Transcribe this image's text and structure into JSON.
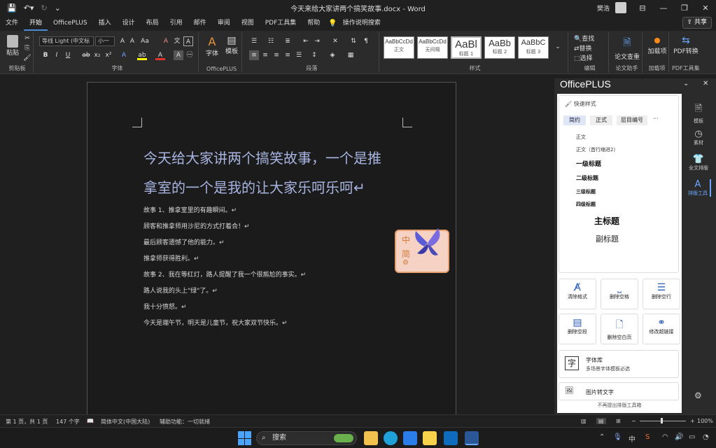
{
  "titlebar": {
    "doc_title": "今天来给大家讲两个搞笑故事.docx - Word",
    "user": "樊浩",
    "minimize": "—",
    "restore": "❐",
    "close": "✕",
    "ribbon_display": "⊟"
  },
  "tabs": [
    "文件",
    "开始",
    "OfficePLUS",
    "插入",
    "设计",
    "布局",
    "引用",
    "邮件",
    "审阅",
    "视图",
    "PDF工具集",
    "帮助",
    "操作说明搜索"
  ],
  "share_label": "共享",
  "ribbon": {
    "clipboard": {
      "paste": "粘贴",
      "label": "剪贴板"
    },
    "font": {
      "name": "等线 Light (中文标",
      "size": "小一",
      "label": "字体"
    },
    "officeplus": {
      "b1": "字体",
      "b2": "模板",
      "label": "OfficePLUS"
    },
    "paragraph": {
      "label": "段落"
    },
    "styles": {
      "label": "样式",
      "items": [
        {
          "sample": "AaBbCcDd",
          "name": "正文"
        },
        {
          "sample": "AaBbCcDd",
          "name": "无间隔"
        },
        {
          "sample": "AaBl",
          "name": "标题 1"
        },
        {
          "sample": "AaBb",
          "name": "标题 2"
        },
        {
          "sample": "AaBbC",
          "name": "标题 3"
        }
      ]
    },
    "editing": {
      "find": "查找",
      "replace": "替换",
      "select": "选择",
      "label": "编辑"
    },
    "compare": {
      "b": "论文查重",
      "label": "论文助手"
    },
    "addin": {
      "b": "加载项",
      "label": "加载项"
    },
    "pdf": {
      "b": "PDF转换",
      "label": "PDF工具集"
    }
  },
  "document": {
    "title_line1": "今天给大家讲两个搞笑故事，一个是推",
    "title_line2": "拿室的一个是我的让大家乐呵乐呵↵",
    "lines": [
      "故事 1、推拿室里的有趣瞬间。↵",
      "顾客和推拿师用沙尼的方式打着合！↵",
      "最后顾客遗憾了他的能力。↵",
      "推拿师获得胜利。↵",
      "故事 2、我在等红灯，路人提醒了我一个很尴尬的事实。↵",
      "路人说我的头上\"绿\"了。↵",
      "我十分愤怒。↵",
      "今天是端午节，明天是儿童节，祝大家双节快乐。↵"
    ]
  },
  "sticker": {
    "chars": [
      "中",
      "简"
    ]
  },
  "pane": {
    "title": "OfficePLUS",
    "section": "快速样式",
    "tabs": [
      "简约",
      "正式",
      "层目编号"
    ],
    "more": "···",
    "styles": [
      "正文",
      "正文（首行缩进2）",
      "一级标题",
      "二级标题",
      "三级标题",
      "四级标题",
      "主标题",
      "副标题"
    ],
    "tools": [
      "清除格式",
      "删除空格",
      "删除空行",
      "删除空段",
      "删除空白页",
      "修改超链接"
    ],
    "fontlib_title": "字体库",
    "fontlib_sub": "多场景字体模板必选",
    "img_text": "图片转文字",
    "footer": "不再提出排版工具箱",
    "side": [
      "模板",
      "素材",
      "全文排版",
      "排版工具"
    ]
  },
  "statusbar": {
    "page": "第 1 页，共 1 页",
    "words": "147 个字",
    "lang": "简体中文(中国大陆)",
    "accessibility": "辅助功能：一切就绪",
    "zoom": "100%"
  },
  "taskbar": {
    "search": "搜索",
    "time": "",
    "date": ""
  }
}
